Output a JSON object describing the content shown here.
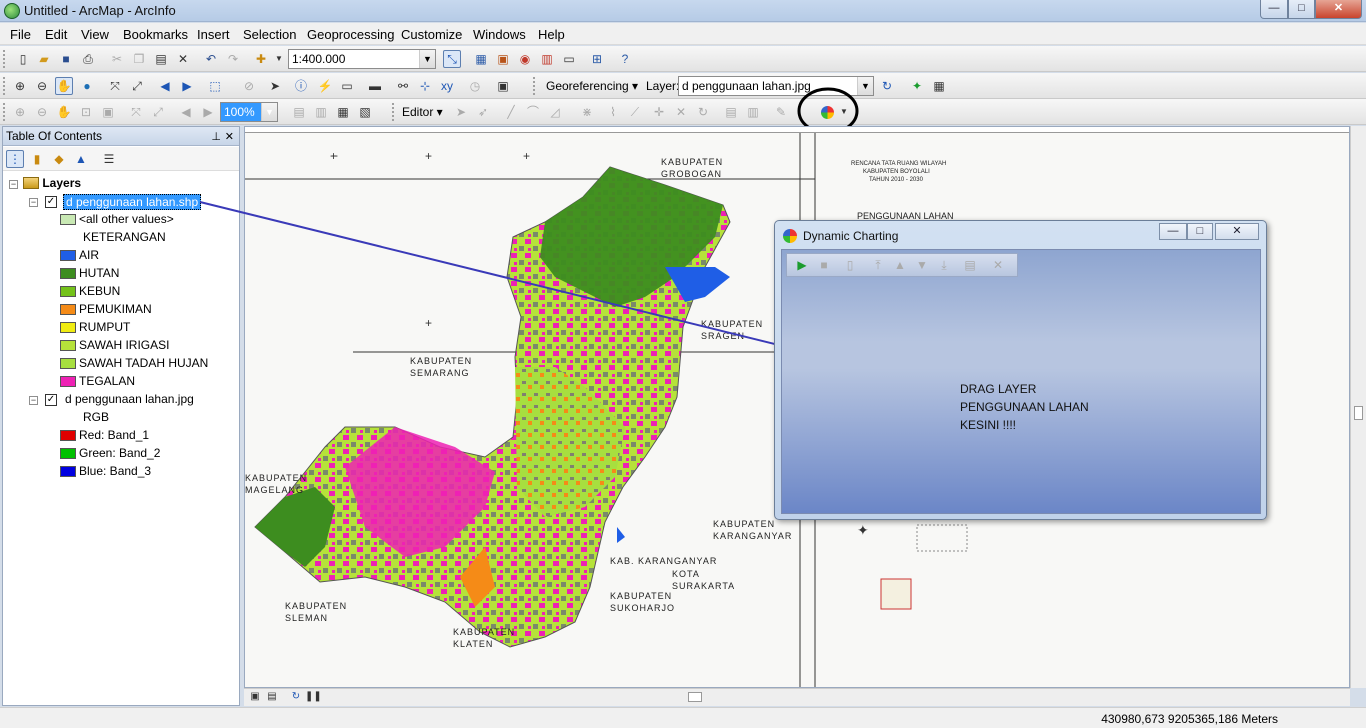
{
  "window": {
    "title": "Untitled - ArcMap - ArcInfo",
    "min": "—",
    "max": "□",
    "close": "✕"
  },
  "menu": [
    "File",
    "Edit",
    "View",
    "Bookmarks",
    "Insert",
    "Selection",
    "Geoprocessing",
    "Customize",
    "Windows",
    "Help"
  ],
  "toolbar": {
    "scale": "1:400.000",
    "georeferencing_label": "Georeferencing ▾",
    "layer_label": "Layer:",
    "layer_value": "d penggunaan lahan.jpg",
    "editor_label": "Editor ▾",
    "zoom_value": "100%"
  },
  "toc": {
    "title": "Table Of Contents",
    "root": "Layers",
    "layer1": {
      "name": "d penggunaan lahan.shp",
      "field": "KETERANGAN",
      "items": [
        {
          "label": "<all other values>",
          "color": "#c9e9b4"
        },
        {
          "label": "AIR",
          "color": "#1f5ee6"
        },
        {
          "label": "HUTAN",
          "color": "#3d8d1f"
        },
        {
          "label": "KEBUN",
          "color": "#74c21a"
        },
        {
          "label": "PEMUKIMAN",
          "color": "#f58b17"
        },
        {
          "label": "RUMPUT",
          "color": "#f0ec12"
        },
        {
          "label": "SAWAH IRIGASI",
          "color": "#b6e23a"
        },
        {
          "label": "SAWAH TADAH HUJAN",
          "color": "#a7df3f"
        },
        {
          "label": "TEGALAN",
          "color": "#ee21b4"
        }
      ]
    },
    "layer2": {
      "name": "d penggunaan lahan.jpg",
      "mode": "RGB",
      "bands": [
        {
          "label": "Red:   Band_1",
          "color": "#e00000"
        },
        {
          "label": "Green:  Band_2",
          "color": "#00c000"
        },
        {
          "label": "Blue:   Band_3",
          "color": "#0000e0"
        }
      ]
    }
  },
  "map_labels": {
    "grobogan": "KABUPATEN\nGROBOGAN",
    "sragen": "KABUPATEN\nSRAGEN",
    "semarang": "KABUPATEN\nSEMARANG",
    "magelang": "KABUPATEN\nMAGELANG",
    "sleman": "KABUPATEN\nSLEMAN",
    "klaten": "KABUPATEN\nKLATEN",
    "karanganyar": "KABUPATEN\nKARANGANYAR",
    "kab_karanganyar": "KAB. KARANGANYAR",
    "surakarta": "KOTA\nSURAKARTA",
    "sukoharjo": "KABUPATEN\nSUKOHARJO",
    "legend_title": "RENCANA TATA RUANG WILAYAH\nKABUPATEN BOYOLALI\nTAHUN 2010 - 2030",
    "legend_sub": "PENGGUNAAN LAHAN"
  },
  "dynamic_charting": {
    "title": "Dynamic Charting",
    "note_line1": "DRAG LAYER",
    "note_line2": "PENGGUNAAN LAHAN",
    "note_line3": "KESINI !!!!"
  },
  "status": {
    "coords": "430980,673  9205365,186 Meters"
  }
}
